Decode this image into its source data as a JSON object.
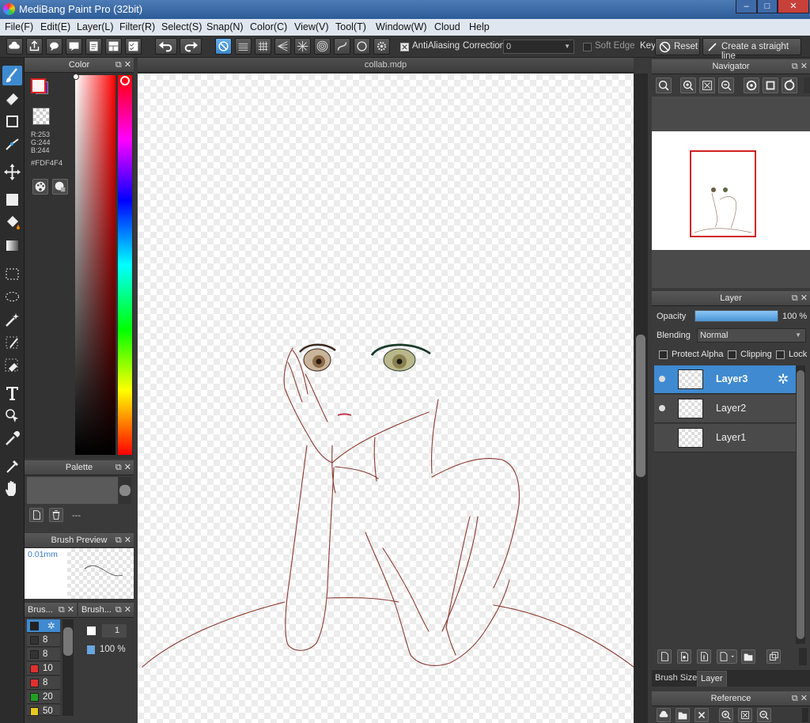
{
  "window": {
    "title": "MediBang Paint Pro (32bit)",
    "controls": [
      "–",
      "□",
      "✕"
    ]
  },
  "menu": [
    "File(F)",
    "Edit(E)",
    "Layer(L)",
    "Filter(R)",
    "Select(S)",
    "Snap(N)",
    "Color(C)",
    "View(V)",
    "Tool(T)",
    "Window(W)",
    "Cloud",
    "Help"
  ],
  "toolbar": {
    "antialiasing_label": "AntiAliasing",
    "correction_label": "Correction",
    "correction_value": "0",
    "soft_edge_label": "Soft Edge",
    "key_label": "Key",
    "reset_label": "Reset",
    "straight_line_label": "Create a straight line"
  },
  "color_panel": {
    "title": "Color",
    "rgb_r": "R:253",
    "rgb_g": "G:244",
    "rgb_b": "B:244",
    "hex": "#FDF4F4",
    "primary_color": "#FDF4F4",
    "secondary_color": "#6a1fa8"
  },
  "palette_panel": {
    "title": "Palette",
    "empty_label": "---"
  },
  "brush_preview": {
    "title": "Brush Preview",
    "size": "0.01mm"
  },
  "brush_panels": {
    "brush_title": "Brus...",
    "brush2_title": "Brush...",
    "sizes": [
      {
        "color": "#222222",
        "value": ""
      },
      {
        "color": "#333333",
        "value": "8"
      },
      {
        "color": "#333333",
        "value": "8"
      },
      {
        "color": "#e03030",
        "value": "10"
      },
      {
        "color": "#e03030",
        "value": "8"
      },
      {
        "color": "#22a022",
        "value": "20"
      },
      {
        "color": "#e8c820",
        "value": "50"
      }
    ],
    "width_value": "1",
    "opacity_value": "100 %"
  },
  "canvas": {
    "tab_title": "collab.mdp"
  },
  "navigator": {
    "title": "Navigator"
  },
  "layer_panel": {
    "title": "Layer",
    "opacity_label": "Opacity",
    "opacity_value": "100 %",
    "opacity_fraction": 1.0,
    "blending_label": "Blending",
    "blending_value": "Normal",
    "protect_alpha_label": "Protect Alpha",
    "clipping_label": "Clipping",
    "lock_label": "Lock",
    "layers": [
      {
        "name": "Layer3",
        "selected": true,
        "visible": true
      },
      {
        "name": "Layer2",
        "selected": false,
        "visible": true
      },
      {
        "name": "Layer1",
        "selected": false,
        "visible": false
      }
    ],
    "tab_brush_size": "Brush Size",
    "tab_layer": "Layer"
  },
  "reference_panel": {
    "title": "Reference"
  },
  "colors": {
    "accent": "#3f8ad1",
    "stroke": "#8a3a30",
    "nav_frame": "#d02020"
  }
}
